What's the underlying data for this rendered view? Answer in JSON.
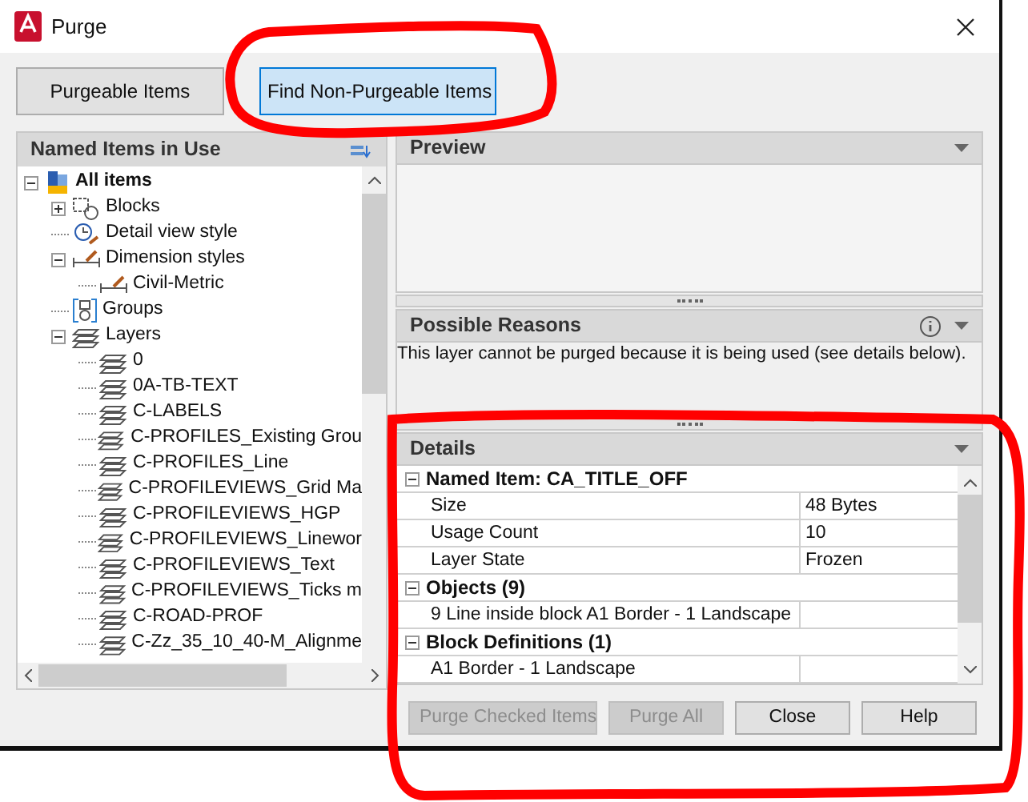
{
  "window": {
    "title": "Purge"
  },
  "tabs": [
    {
      "label": "Purgeable Items",
      "selected": false
    },
    {
      "label": "Find Non-Purgeable Items",
      "selected": true
    }
  ],
  "tree": {
    "title": "Named Items in Use",
    "items": [
      {
        "label": "All items",
        "kind": "root",
        "expanded": true,
        "children": [
          {
            "label": "Blocks",
            "kind": "block",
            "expanded": false
          },
          {
            "label": "Detail view style",
            "kind": "detail-view-style"
          },
          {
            "label": "Dimension styles",
            "kind": "dimension-style",
            "expanded": true,
            "children": [
              {
                "label": "Civil-Metric",
                "kind": "dimension-style"
              }
            ]
          },
          {
            "label": "Groups",
            "kind": "group"
          },
          {
            "label": "Layers",
            "kind": "layer",
            "expanded": true,
            "children": [
              {
                "label": "0",
                "kind": "layer"
              },
              {
                "label": "0A-TB-TEXT",
                "kind": "layer"
              },
              {
                "label": "C-LABELS",
                "kind": "layer"
              },
              {
                "label": "C-PROFILES_Existing Grou",
                "kind": "layer"
              },
              {
                "label": "C-PROFILES_Line",
                "kind": "layer"
              },
              {
                "label": "C-PROFILEVIEWS_Grid Ma",
                "kind": "layer"
              },
              {
                "label": "C-PROFILEVIEWS_HGP",
                "kind": "layer"
              },
              {
                "label": "C-PROFILEVIEWS_Linewor",
                "kind": "layer"
              },
              {
                "label": "C-PROFILEVIEWS_Text",
                "kind": "layer"
              },
              {
                "label": "C-PROFILEVIEWS_Ticks m",
                "kind": "layer"
              },
              {
                "label": "C-ROAD-PROF",
                "kind": "layer"
              },
              {
                "label": "C-Zz_35_10_40-M_Alignme",
                "kind": "layer"
              }
            ]
          }
        ]
      }
    ]
  },
  "preview": {
    "title": "Preview"
  },
  "reasons": {
    "title": "Possible Reasons",
    "text": "This layer cannot be purged because it is being used (see details below)."
  },
  "details": {
    "title": "Details",
    "sections": [
      {
        "title": "Named Item: CA_TITLE_OFF",
        "expanded": true,
        "rows": [
          {
            "name": "Size",
            "value": "48 Bytes"
          },
          {
            "name": "Usage Count",
            "value": "10"
          },
          {
            "name": "Layer State",
            "value": "Frozen"
          }
        ]
      },
      {
        "title": "Objects (9)",
        "expanded": true,
        "rows": [
          {
            "name": "9 Line inside block A1 Border - 1 Landscape"
          }
        ]
      },
      {
        "title": "Block Definitions (1)",
        "expanded": true,
        "rows": [
          {
            "name": "A1 Border - 1 Landscape"
          }
        ]
      }
    ]
  },
  "buttons": [
    {
      "label": "Purge Checked Items",
      "disabled": true
    },
    {
      "label": "Purge All",
      "disabled": true
    },
    {
      "label": "Close",
      "disabled": false
    },
    {
      "label": "Help",
      "disabled": false
    }
  ]
}
